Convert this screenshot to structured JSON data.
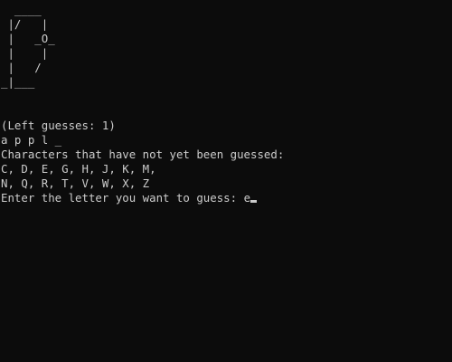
{
  "terminal": {
    "hangman_art": [
      "  ____",
      " |/   |",
      " |   _O_",
      " |    |",
      " |   /",
      "_|___"
    ],
    "left_guesses": "(Left guesses: 1)",
    "word_progress": "a p p l _",
    "not_guessed_header": "Characters that have not yet been guessed:",
    "remaining_row_1": "C, D, E, G, H, J, K, M,",
    "remaining_row_2": "N, Q, R, T, V, W, X, Z",
    "prompt": "Enter the letter you want to guess: ",
    "typed_input": "e"
  },
  "colors": {
    "background": "#0c0c0c",
    "text": "#cccccc"
  }
}
